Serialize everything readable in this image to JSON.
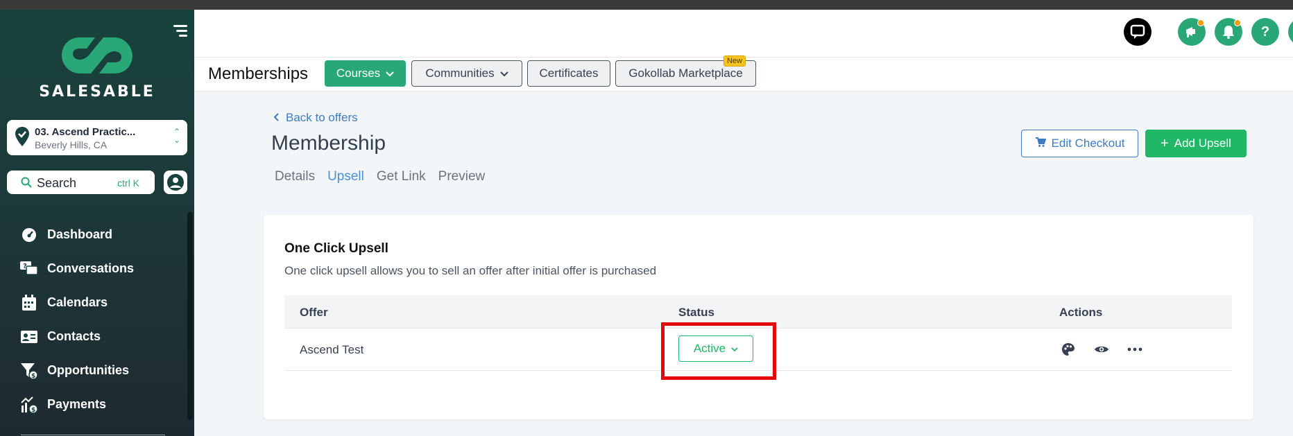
{
  "brand": {
    "name": "SALESABLE"
  },
  "location": {
    "name": "03. Ascend Practic...",
    "address": "Beverly Hills, CA"
  },
  "search": {
    "label": "Search",
    "shortcut": "ctrl K"
  },
  "nav": [
    {
      "label": "Dashboard",
      "icon": "dashboard-icon"
    },
    {
      "label": "Conversations",
      "icon": "conversations-icon"
    },
    {
      "label": "Calendars",
      "icon": "calendar-icon"
    },
    {
      "label": "Contacts",
      "icon": "contacts-icon"
    },
    {
      "label": "Opportunities",
      "icon": "opportunities-icon"
    },
    {
      "label": "Payments",
      "icon": "payments-icon"
    }
  ],
  "tabbar": {
    "title": "Memberships",
    "tabs": [
      {
        "label": "Courses",
        "active": true,
        "dropdown": true
      },
      {
        "label": "Communities",
        "dropdown": true
      },
      {
        "label": "Certificates"
      },
      {
        "label": "Gokollab Marketplace",
        "badge": "New"
      }
    ]
  },
  "page": {
    "back_label": "Back to offers",
    "title": "Membership",
    "subtabs": [
      "Details",
      "Upsell",
      "Get Link",
      "Preview"
    ],
    "active_subtab": "Upsell",
    "edit_checkout_label": "Edit Checkout",
    "add_upsell_label": "Add Upsell"
  },
  "upsell": {
    "title": "One Click Upsell",
    "description": "One click upsell allows you to sell an offer after initial offer is purchased",
    "columns": {
      "offer": "Offer",
      "status": "Status",
      "actions": "Actions"
    },
    "rows": [
      {
        "offer": "Ascend Test",
        "status": "Active"
      }
    ]
  },
  "colors": {
    "accent": "#20b866",
    "link": "#3e7bc2",
    "highlight": "#e4080a",
    "sidebar": "#17433c"
  }
}
